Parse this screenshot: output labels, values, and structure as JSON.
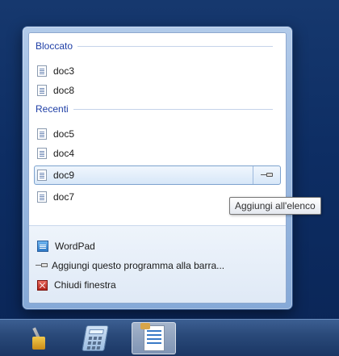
{
  "jumplist": {
    "pinned_header": "Bloccato",
    "pinned_items": [
      {
        "label": "doc3",
        "icon": "document-icon"
      },
      {
        "label": "doc8",
        "icon": "document-icon"
      }
    ],
    "recent_header": "Recenti",
    "recent_items": [
      {
        "label": "doc5",
        "icon": "document-icon"
      },
      {
        "label": "doc4",
        "icon": "document-icon"
      },
      {
        "label": "doc9",
        "icon": "document-icon"
      },
      {
        "label": "doc7",
        "icon": "document-icon"
      }
    ],
    "tasks": {
      "open_app_label": "WordPad",
      "pin_program_label": "Aggiungi questo programma alla barra...",
      "close_window_label": "Chiudi finestra"
    }
  },
  "tooltip": {
    "text": "Aggiungi all'elenco"
  },
  "taskbar": {
    "buttons": [
      {
        "name": "tools-app",
        "icon": "tools-icon"
      },
      {
        "name": "calculator",
        "icon": "calculator-icon"
      },
      {
        "name": "wordpad",
        "icon": "wordpad-icon",
        "active": true
      }
    ]
  },
  "colors": {
    "header_text": "#1f3fa6",
    "desktop_bg": "#0d2d63",
    "highlight_border": "#7da2ce"
  }
}
